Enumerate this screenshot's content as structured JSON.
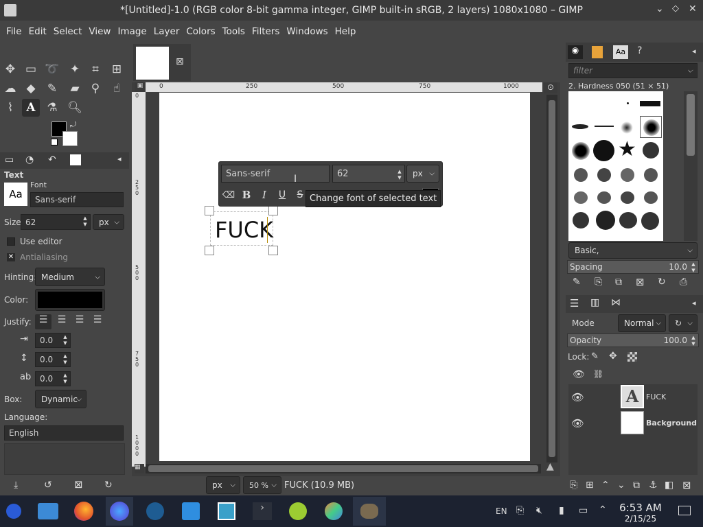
{
  "window": {
    "title": "*[Untitled]-1.0 (RGB color 8-bit gamma integer, GIMP built-in sRGB, 2 layers) 1080x1080 – GIMP"
  },
  "menu": [
    "File",
    "Edit",
    "Select",
    "View",
    "Image",
    "Layer",
    "Colors",
    "Tools",
    "Filters",
    "Windows",
    "Help"
  ],
  "tool_options": {
    "title": "Text",
    "font_label": "Font",
    "font_preview": "Aa",
    "font_value": "Sans-serif",
    "size_label": "Size:",
    "size_value": "62",
    "size_unit": "px",
    "use_editor": "Use editor",
    "antialiasing": "Antialiasing",
    "hinting_label": "Hinting:",
    "hinting_value": "Medium",
    "color_label": "Color:",
    "justify_label": "Justify:",
    "indent": "0.0",
    "line_spacing": "0.0",
    "letter_spacing": "0.0",
    "box_label": "Box:",
    "box_value": "Dynamic",
    "language_label": "Language:",
    "language_value": "English"
  },
  "canvas": {
    "ruler_ticks": [
      "0",
      "250",
      "500",
      "750",
      "1000"
    ],
    "ruler_v_ticks": [
      "0",
      "2 5 0",
      "5 0 0",
      "7 5 0",
      "1 0 0 0"
    ],
    "text": "FUCK",
    "unit": "px",
    "zoom": "50 %",
    "status": "FUCK (10.9 MB)"
  },
  "text_toolbar": {
    "font": "Sans-serif",
    "size": "62",
    "unit": "px",
    "tooltip": "Change font of selected text"
  },
  "brushes": {
    "filter_placeholder": "filter",
    "current": "2. Hardness 050 (51 × 51)",
    "preset": "Basic,",
    "spacing_label": "Spacing",
    "spacing_value": "10.0"
  },
  "layers": {
    "mode_label": "Mode",
    "mode_value": "Normal",
    "opacity_label": "Opacity",
    "opacity_value": "100.0",
    "lock_label": "Lock:",
    "items": [
      {
        "name": "FUCK"
      },
      {
        "name": "Background"
      }
    ]
  },
  "taskbar": {
    "lang": "EN",
    "time": "6:53 AM",
    "date": "2/15/25"
  }
}
